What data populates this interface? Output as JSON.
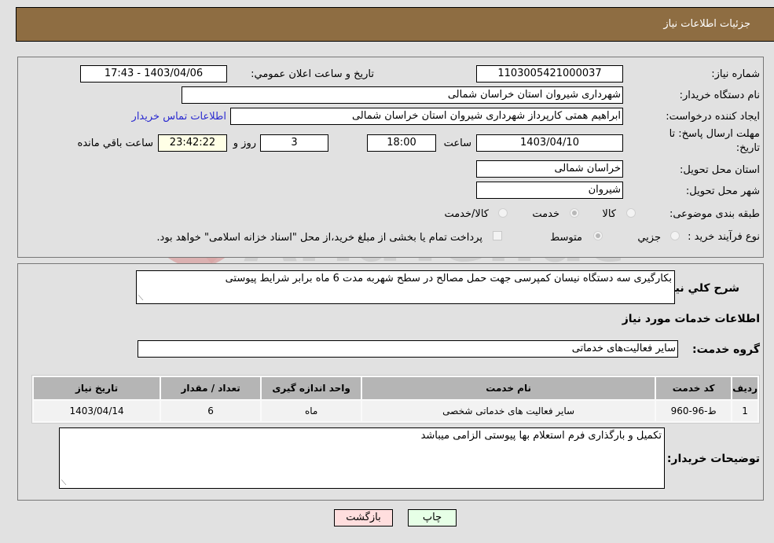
{
  "header": {
    "title": "جزئیات اطلاعات نیاز"
  },
  "details": {
    "need_number_label": "شماره نیاز:",
    "need_number": "1103005421000037",
    "announce_label": "تاریخ و ساعت اعلان عمومي:",
    "announce_value": "1403/04/06 - 17:43",
    "buyer_org_label": "نام دستگاه خریدار:",
    "buyer_org": "شهرداری شیروان استان خراسان شمالی",
    "creator_label": "ایجاد کننده درخواست:",
    "creator": "ابراهیم همتی کارپرداز شهرداری شیروان استان خراسان شمالی",
    "contact_link": "اطلاعات تماس خریدار",
    "deadline_label_line1": "مهلت ارسال پاسخ: تا",
    "deadline_label_line2": "تاریخ:",
    "deadline_date": "1403/04/10",
    "time_label": "ساعت",
    "deadline_time": "18:00",
    "days_value": "3",
    "days_label": "روز و",
    "remaining_time": "23:42:22",
    "remaining_label": "ساعت باقي مانده",
    "province_label": "استان محل تحویل:",
    "province": "خراسان شمالی",
    "city_label": "شهر محل تحویل:",
    "city": "شیروان",
    "category_label": "طبقه بندی موضوعی:",
    "category_options": [
      "کالا",
      "خدمت",
      "کالا/خدمت"
    ],
    "category_selected": "خدمت",
    "process_label": "نوع فرآیند خرید :",
    "process_options": [
      "جزیي",
      "متوسط"
    ],
    "process_selected": "متوسط",
    "treasury_note": "پرداخت تمام یا بخشی از مبلغ خرید،از محل \"اسناد خزانه اسلامی\" خواهد بود.",
    "treasury_checked": false
  },
  "need": {
    "summary_label": "شرح کلي نیاز:",
    "summary": "بکارگیری سه دستگاه نیسان کمپرسی جهت حمل مصالح در سطح شهربه مدت 6 ماه برابر شرایط پیوستی",
    "services_title": "اطلاعات خدمات مورد نیاز",
    "service_group_label": "گروه خدمت:",
    "service_group": "سایر فعالیت‌های خدماتی"
  },
  "table": {
    "headers": [
      "ردیف",
      "کد خدمت",
      "نام خدمت",
      "واحد اندازه گیری",
      "تعداد / مقدار",
      "تاریخ نیاز"
    ],
    "rows": [
      [
        "1",
        "ط-96-960",
        "سایر فعالیت های خدماتی شخصی",
        "ماه",
        "6",
        "1403/04/14"
      ]
    ]
  },
  "buyer_notes": {
    "label": "توضیحات خریدار:",
    "text": "تکمیل و بارگذاری فرم استعلام بها پیوستی الزامی میباشد"
  },
  "buttons": {
    "print": "چاپ",
    "back": "بازگشت"
  },
  "watermark": {
    "text": "AriaTender.neT"
  }
}
